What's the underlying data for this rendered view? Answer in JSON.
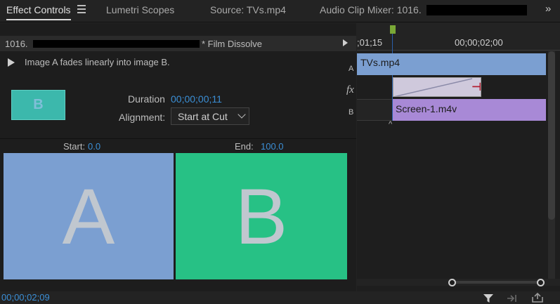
{
  "tabs": {
    "effect_controls": "Effect Controls",
    "lumetri": "Lumetri Scopes",
    "source": "Source: TVs.mp4",
    "audio_mixer": "Audio Clip Mixer: 1016.",
    "overflow": "»"
  },
  "clip_header": {
    "prefix": "1016.",
    "suffix": "* Film Dissolve"
  },
  "effect": {
    "description": "Image A fades linearly into image B.",
    "thumb_letter": "B",
    "duration_label": "Duration",
    "duration_value": "00;00;00;11",
    "alignment_label": "Alignment:",
    "alignment_value": "Start at Cut",
    "start_label": "Start:",
    "start_value": "0.0",
    "end_label": "End:",
    "end_value": "100.0",
    "preview_a_letter": "A",
    "preview_b_letter": "B"
  },
  "footer": {
    "timecode": "00;00;02;09"
  },
  "timeline": {
    "ruler_tc1": ";01;15",
    "ruler_tc2": "00;00;02;00",
    "track_a": "A",
    "track_fx": "fx",
    "track_b": "B",
    "clip_a_name": "TVs.mp4",
    "clip_b_name": "Screen-1.m4v",
    "transition_marker": "⊣"
  },
  "colors": {
    "accent_blue": "#3b8fd6",
    "preview_a": "#7b9fd1",
    "preview_b": "#27c185",
    "clip_b": "#a889d6",
    "playhead": "#7aa836"
  }
}
